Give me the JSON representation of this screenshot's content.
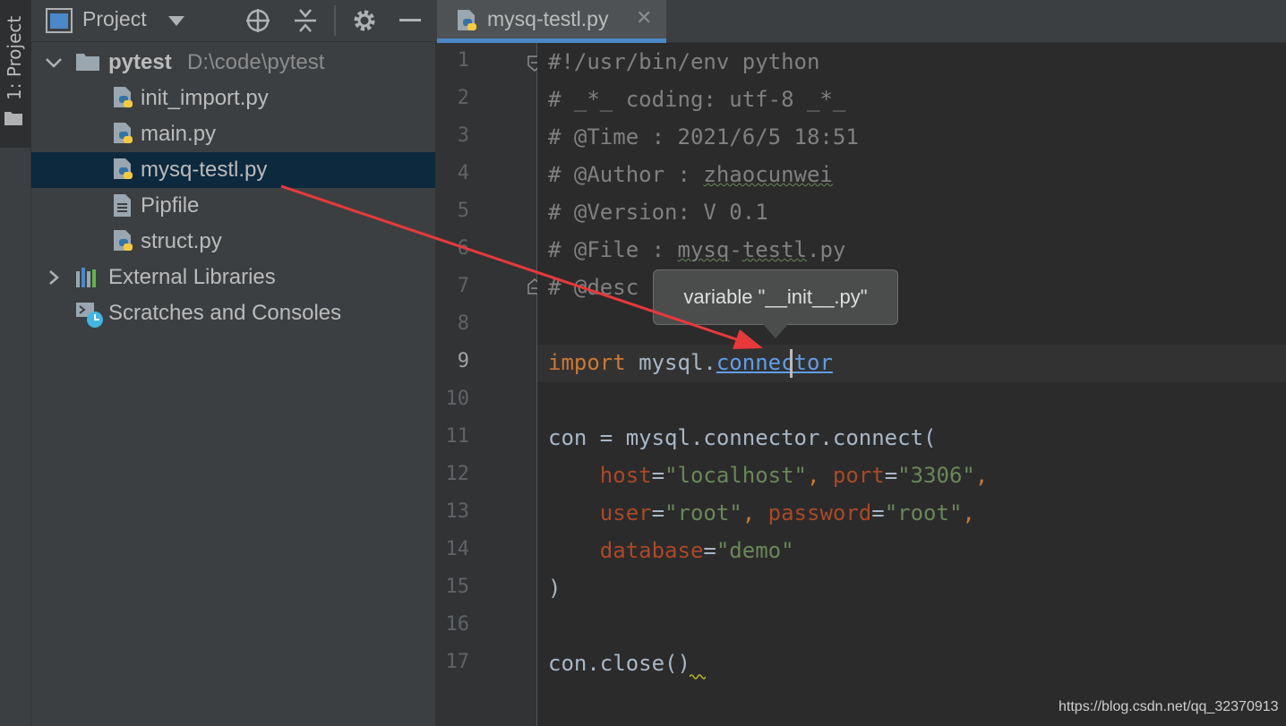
{
  "tool_window": {
    "label": "1: Project"
  },
  "project_panel": {
    "title": "Project",
    "tree": [
      {
        "name": "pytest",
        "path": "D:\\code\\pytest"
      },
      {
        "name": "init_import.py"
      },
      {
        "name": "main.py"
      },
      {
        "name": "mysq-testl.py"
      },
      {
        "name": "Pipfile"
      },
      {
        "name": "struct.py"
      },
      {
        "name": "External Libraries"
      },
      {
        "name": "Scratches and Consoles"
      }
    ]
  },
  "editor": {
    "tab_label": "mysq-testl.py",
    "tab_close": "✕",
    "line_numbers": [
      "1",
      "2",
      "3",
      "4",
      "5",
      "6",
      "7",
      "8",
      "9",
      "10",
      "11",
      "12",
      "13",
      "14",
      "15",
      "16",
      "17"
    ],
    "lines": {
      "l1": "#!/usr/bin/env python",
      "l2": "# _*_ coding: utf-8 _*_",
      "l3": "# @Time : 2021/6/5 18:51",
      "l4a": "# @Author : ",
      "l4b": "zhaocunwei",
      "l5": "# @Version: V 0.1",
      "l6a": "# @File : ",
      "l6b": "mysq",
      "l6c": "-",
      "l6d": "testl",
      "l6e": ".py",
      "l7": "# @desc",
      "l9a": "import",
      "l9b": " mysql.",
      "l9c": "connector",
      "l11": "con = mysql.connector.connect(",
      "l12a": "    ",
      "l12b": "host",
      "l12c": "=",
      "l12d": "\"localhost\"",
      "l12e": ", ",
      "l12f": "port",
      "l12g": "=",
      "l12h": "\"3306\"",
      "l12i": ",",
      "l13a": "    ",
      "l13b": "user",
      "l13c": "=",
      "l13d": "\"root\"",
      "l13e": ", ",
      "l13f": "password",
      "l13g": "=",
      "l13h": "\"root\"",
      "l13i": ",",
      "l14a": "    ",
      "l14b": "database",
      "l14c": "=",
      "l14d": "\"demo\"",
      "l15": ")",
      "l17": "con.close()"
    },
    "tooltip": "variable \"__init__.py\""
  },
  "watermark": "https://blog.csdn.net/qq_32370913",
  "colors": {
    "selection": "#0d293e",
    "accent": "#4a88c7",
    "keyword": "#cc7832",
    "string": "#6a8759",
    "parameter": "#aa4926",
    "arrow": "#e8393a"
  }
}
